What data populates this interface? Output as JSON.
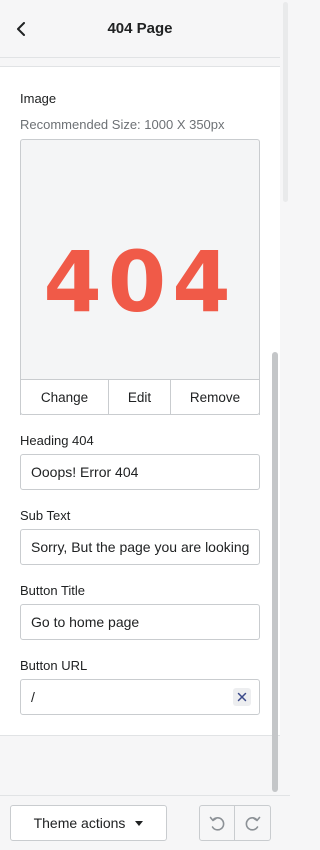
{
  "header": {
    "title": "404 Page"
  },
  "image_section": {
    "label": "Image",
    "hint": "Recommended Size: 1000 X 350px",
    "image_text": "404",
    "actions": {
      "change": "Change",
      "edit": "Edit",
      "remove": "Remove"
    }
  },
  "fields": {
    "heading": {
      "label": "Heading 404",
      "value": "Ooops! Error 404"
    },
    "sub_text": {
      "label": "Sub Text",
      "value": "Sorry, But the page you are looking"
    },
    "button_title": {
      "label": "Button Title",
      "value": "Go to home page"
    },
    "button_url": {
      "label": "Button URL",
      "value": "/"
    }
  },
  "footer": {
    "theme_actions": "Theme actions"
  },
  "colors": {
    "accent_404": "#f05a48"
  },
  "icons": [
    "chevron-left-icon",
    "close-icon",
    "caret-down-icon",
    "undo-icon",
    "redo-icon"
  ]
}
